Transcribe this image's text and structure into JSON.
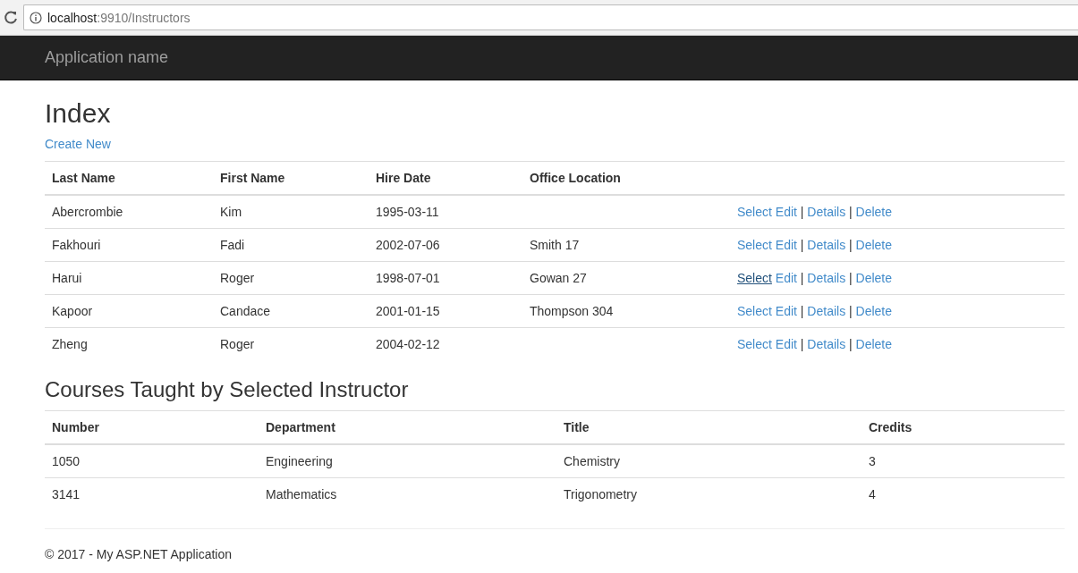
{
  "browser": {
    "url_host": "localhost",
    "url_path": ":9910/Instructors"
  },
  "navbar": {
    "brand": "Application name"
  },
  "page": {
    "title": "Index",
    "create_link": "Create New"
  },
  "instructors": {
    "columns": [
      "Last Name",
      "First Name",
      "Hire Date",
      "Office Location"
    ],
    "rows": [
      {
        "cells": [
          "Abercrombie",
          "Kim",
          "1995-03-11",
          ""
        ],
        "actions": [
          {
            "kind": "link",
            "label": "Select",
            "hovered": false
          },
          {
            "kind": "link",
            "label": "Edit",
            "hovered": false
          },
          {
            "kind": "separator",
            "label": "|"
          },
          {
            "kind": "link",
            "label": "Details",
            "hovered": false
          },
          {
            "kind": "separator",
            "label": "|"
          },
          {
            "kind": "link",
            "label": "Delete",
            "hovered": false
          }
        ]
      },
      {
        "cells": [
          "Fakhouri",
          "Fadi",
          "2002-07-06",
          "Smith 17"
        ],
        "actions": [
          {
            "kind": "link",
            "label": "Select",
            "hovered": false
          },
          {
            "kind": "link",
            "label": "Edit",
            "hovered": false
          },
          {
            "kind": "separator",
            "label": "|"
          },
          {
            "kind": "link",
            "label": "Details",
            "hovered": false
          },
          {
            "kind": "separator",
            "label": "|"
          },
          {
            "kind": "link",
            "label": "Delete",
            "hovered": false
          }
        ]
      },
      {
        "cells": [
          "Harui",
          "Roger",
          "1998-07-01",
          "Gowan 27"
        ],
        "actions": [
          {
            "kind": "link",
            "label": "Select",
            "hovered": true
          },
          {
            "kind": "link",
            "label": "Edit",
            "hovered": false
          },
          {
            "kind": "separator",
            "label": "|"
          },
          {
            "kind": "link",
            "label": "Details",
            "hovered": false
          },
          {
            "kind": "separator",
            "label": "|"
          },
          {
            "kind": "link",
            "label": "Delete",
            "hovered": false
          }
        ]
      },
      {
        "cells": [
          "Kapoor",
          "Candace",
          "2001-01-15",
          "Thompson 304"
        ],
        "actions": [
          {
            "kind": "link",
            "label": "Select",
            "hovered": false
          },
          {
            "kind": "link",
            "label": "Edit",
            "hovered": false
          },
          {
            "kind": "separator",
            "label": "|"
          },
          {
            "kind": "link",
            "label": "Details",
            "hovered": false
          },
          {
            "kind": "separator",
            "label": "|"
          },
          {
            "kind": "link",
            "label": "Delete",
            "hovered": false
          }
        ]
      },
      {
        "cells": [
          "Zheng",
          "Roger",
          "2004-02-12",
          ""
        ],
        "actions": [
          {
            "kind": "link",
            "label": "Select",
            "hovered": false
          },
          {
            "kind": "link",
            "label": "Edit",
            "hovered": false
          },
          {
            "kind": "separator",
            "label": "|"
          },
          {
            "kind": "link",
            "label": "Details",
            "hovered": false
          },
          {
            "kind": "separator",
            "label": "|"
          },
          {
            "kind": "link",
            "label": "Delete",
            "hovered": false
          }
        ]
      }
    ]
  },
  "courses": {
    "title": "Courses Taught by Selected Instructor",
    "columns": [
      "Number",
      "Department",
      "Title",
      "Credits"
    ],
    "rows": [
      [
        "1050",
        "Engineering",
        "Chemistry",
        "3"
      ],
      [
        "3141",
        "Mathematics",
        "Trigonometry",
        "4"
      ]
    ]
  },
  "footer": {
    "text": "© 2017 - My ASP.NET Application"
  }
}
